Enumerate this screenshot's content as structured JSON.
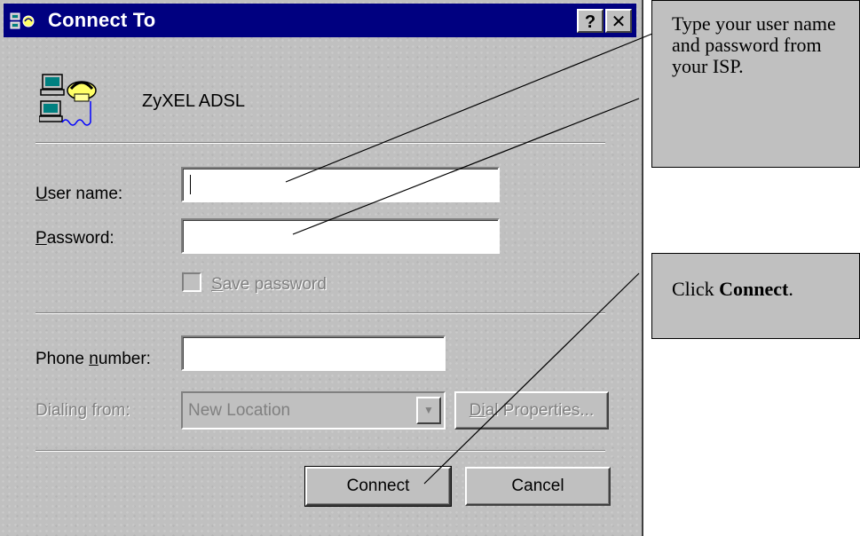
{
  "dialog": {
    "title": "Connect To",
    "help_button": "?",
    "close_button": "✕",
    "connection_name": "ZyXEL ADSL",
    "user_name": {
      "label_prefix": "",
      "label_accel": "U",
      "label_rest": "ser name:",
      "value": ""
    },
    "password": {
      "label_accel": "P",
      "label_rest": "assword:",
      "value": ""
    },
    "save_password": {
      "label_accel": "S",
      "label_rest": "ave password",
      "checked": false
    },
    "phone_number": {
      "label_prefix": "Phone ",
      "label_accel": "n",
      "label_rest": "umber:",
      "value": ""
    },
    "dialing_from": {
      "label": "Dialing from:",
      "value": "New Location"
    },
    "dial_properties": {
      "label_accel": "D",
      "label_middle": "i",
      "label_rest": "al Properties..."
    },
    "connect_button": "Connect",
    "cancel_button": "Cancel"
  },
  "callouts": {
    "credentials": "Type your user name and password from your ISP.",
    "connect_prefix": "Click ",
    "connect_bold": "Connect",
    "connect_suffix": "."
  },
  "icons": {
    "title": "dialup-networking-icon",
    "connection": "computers-phone-icon",
    "combo": "chevron-down-icon"
  }
}
